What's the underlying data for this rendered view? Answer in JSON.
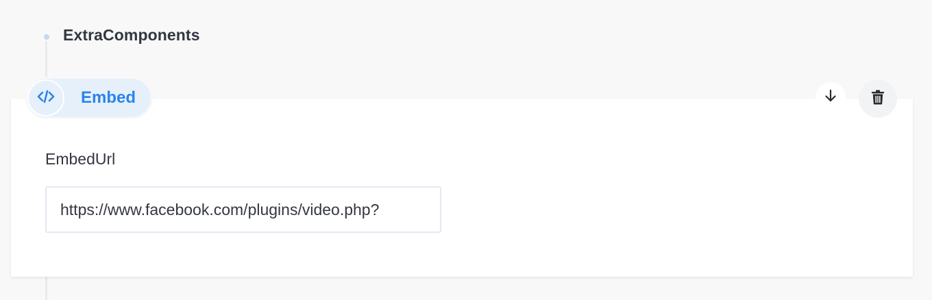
{
  "section": {
    "title": "ExtraComponents"
  },
  "component": {
    "name": "Embed",
    "icon": "code-icon",
    "accent_color": "#2b84ea"
  },
  "actions": {
    "move_down_icon": "arrow-down-icon",
    "delete_icon": "trash-icon"
  },
  "fields": {
    "embed_url": {
      "label": "EmbedUrl",
      "value": "https://www.facebook.com/plugins/video.php?"
    }
  }
}
